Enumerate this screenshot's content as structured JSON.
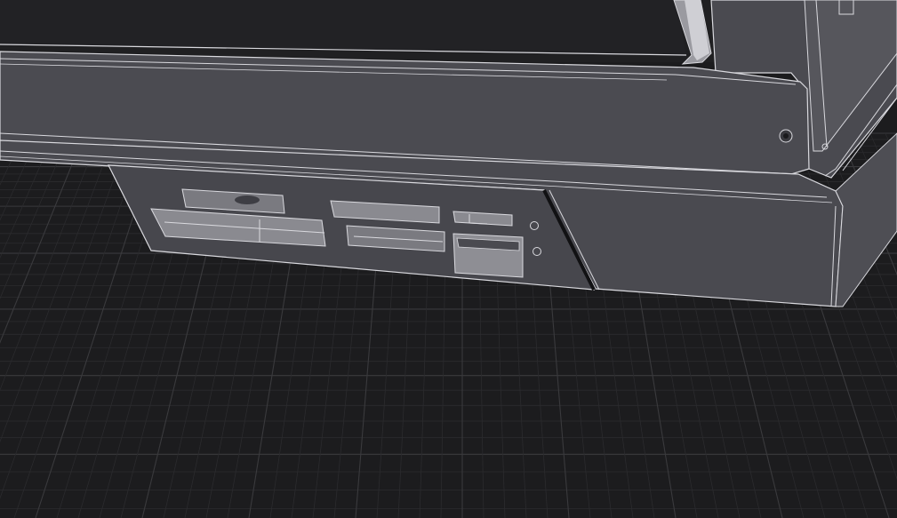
{
  "viewport": {
    "background_color": "#1c1c1e",
    "grid_line_color": "#3a3a3d",
    "grid_minor_color": "#2b2b2e",
    "grid": true
  },
  "model": {
    "body_color": "#4a4a50",
    "body_light_color": "#59595f",
    "panel_color": "#3f3f45",
    "edge_color": "#d9d9de",
    "cutout_color": "#7a7a80",
    "cutout_light_color": "#8e8e94",
    "dark_gap_color": "#111113"
  }
}
